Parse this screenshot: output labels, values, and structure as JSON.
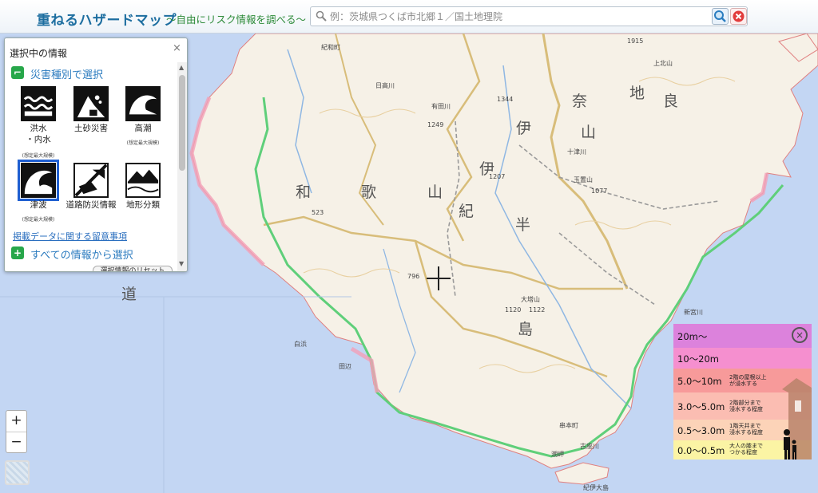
{
  "header": {
    "title": "重ねるハザードマップ",
    "subtitle": "～自由にリスク情報を調べる～",
    "search_placeholder": "例：茨城県つくば市北郷１／国土地理院"
  },
  "panel": {
    "title": "選択中の情報",
    "close": "×",
    "section_disaster": "災害種別で選択",
    "hazards": [
      {
        "label": "洪水\n・内水",
        "sub": "(想定最大規模)",
        "icon": "flood-icon"
      },
      {
        "label": "土砂災害",
        "sub": "",
        "icon": "landslide-icon"
      },
      {
        "label": "高潮",
        "sub": "(想定最大規模)",
        "icon": "storm-surge-icon"
      },
      {
        "label": "津波",
        "sub": "(想定最大規模)",
        "icon": "tsunami-icon",
        "selected": true
      },
      {
        "label": "道路防災情報",
        "sub": "",
        "icon": "road-disaster-icon"
      },
      {
        "label": "地形分類",
        "sub": "",
        "icon": "landform-icon"
      }
    ],
    "notice_link": "掲載データに関する留意事項",
    "section_all": "すべての情報から選択",
    "cut_button": "選択情報のリセット"
  },
  "map": {
    "region_labels": [
      "和",
      "歌",
      "山",
      "紀",
      "伊",
      "半",
      "島",
      "奈",
      "良",
      "山",
      "地",
      "伊",
      "道"
    ],
    "places": [
      "紀和町",
      "上北山",
      "十津川",
      "玉置山",
      "大塔山",
      "串本町",
      "古座川",
      "潮岬",
      "新宮川",
      "紀伊大島",
      "白浜",
      "田辺",
      "有田川",
      "日高川",
      "1915",
      "1344",
      "1077",
      "1207",
      "1120",
      "1122",
      "1249",
      "796",
      "523"
    ]
  },
  "zoom": {
    "in": "+",
    "out": "−"
  },
  "legend": {
    "close": "×",
    "rows": [
      {
        "label": "20m～",
        "note": "",
        "color": "#dc82dc"
      },
      {
        "label": "10～20m",
        "note": "",
        "color": "#f58fcf"
      },
      {
        "label": "5.0～10m",
        "note": "2階の屋根以上\nが浸水する",
        "color": "#f79a9a"
      },
      {
        "label": "3.0～5.0m",
        "note": "2階部分まで\n浸水する程度",
        "color": "#fbbdb2"
      },
      {
        "label": "0.5～3.0m",
        "note": "1階天井まで\n浸水する程度",
        "color": "#fcd3b8"
      },
      {
        "label": "0.0～0.5m",
        "note": "大人の膝まで\nつかる程度",
        "color": "#fbf4a4"
      }
    ]
  }
}
